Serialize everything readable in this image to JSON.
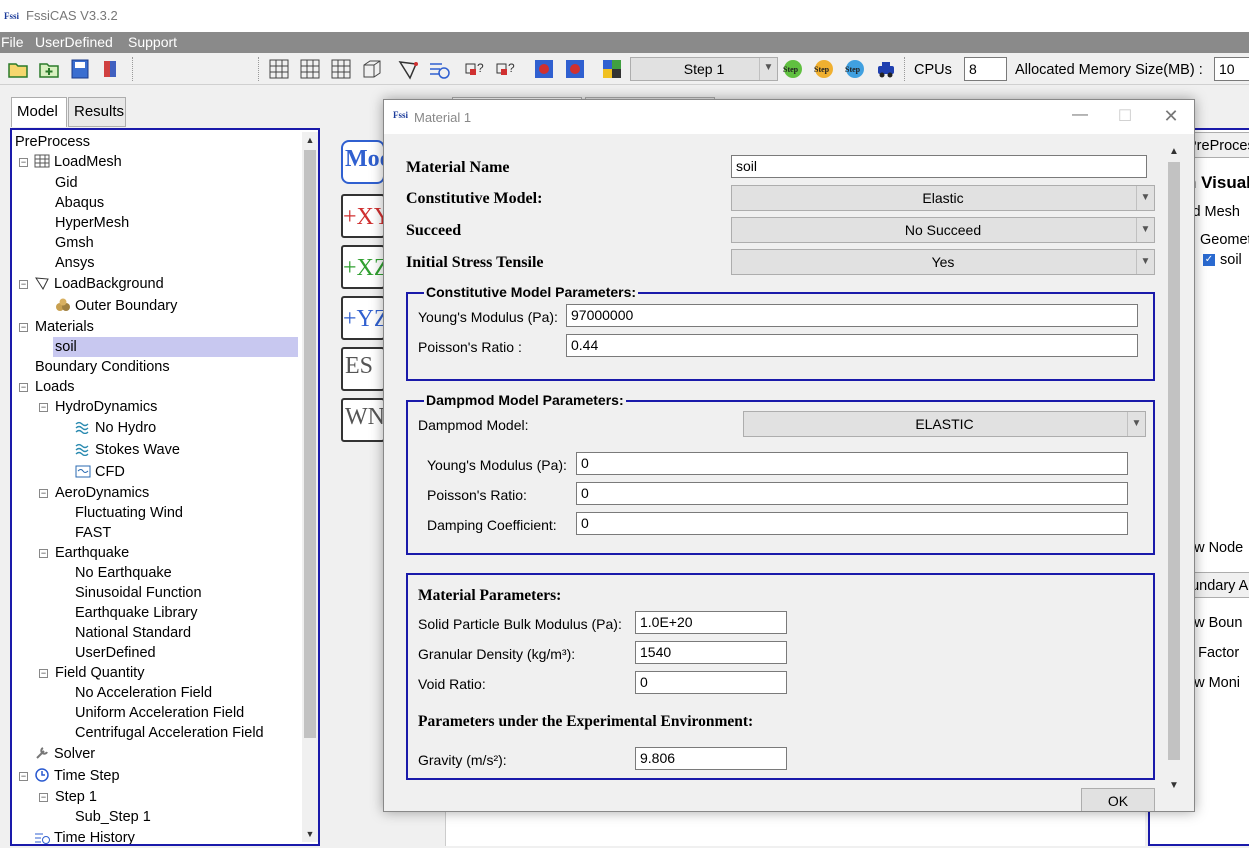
{
  "app": {
    "title": "FssiCAS V3.3.2",
    "logo_text": "FssiCAS"
  },
  "menu": [
    "File",
    "UserDefined",
    "Support"
  ],
  "toolbar": {
    "step_select": "Step 1",
    "step_buttons": [
      "Step",
      "Step",
      "Step"
    ],
    "cpus_label": "CPUs",
    "cpus_value": "8",
    "memory_label": "Allocated Memory Size(MB) :",
    "memory_value": "10"
  },
  "left_tabs": [
    "Model",
    "Results"
  ],
  "tree": {
    "root": "PreProcess",
    "load_mesh": "LoadMesh",
    "mesh_items": [
      "Gid",
      "Abaqus",
      "HyperMesh",
      "Gmsh",
      "Ansys"
    ],
    "load_background": "LoadBackground",
    "outer_boundary": "Outer Boundary",
    "materials": "Materials",
    "soil": "soil",
    "boundary_conditions": "Boundary Conditions",
    "loads": "Loads",
    "hydrodynamics": "HydroDynamics",
    "hydro_items": [
      "No Hydro",
      "Stokes Wave",
      "CFD"
    ],
    "aerodynamics": "AeroDynamics",
    "aero_items": [
      "Fluctuating Wind",
      "FAST"
    ],
    "earthquake": "Earthquake",
    "earthquake_items": [
      "No Earthquake",
      "Sinusoidal Function",
      "Earthquake Library",
      "National Standard",
      "UserDefined"
    ],
    "field_quantity": "Field Quantity",
    "field_items": [
      "No Acceleration Field",
      "Uniform Acceleration Field",
      "Centrifugal Acceleration Field"
    ],
    "solver": "Solver",
    "time_step": "Time Step",
    "step1": "Step 1",
    "sub_step": "Sub_Step 1",
    "time_history": "Time History"
  },
  "right_panel": {
    "tab": "PreProces",
    "heading": "n Visual",
    "items": [
      "lid Mesh",
      "Geomet",
      "soil",
      "ow Node",
      "oundary A",
      "ow Boun",
      "n Factor",
      "ow Moni"
    ]
  },
  "dialog": {
    "title": "Material 1",
    "material_name_label": "Material Name",
    "material_name_value": "soil",
    "constitutive_label": "Constitutive Model:",
    "constitutive_value": "Elastic",
    "succeed_label": "Succeed",
    "succeed_value": "No Succeed",
    "initial_stress_label": "Initial Stress Tensile",
    "initial_stress_value": "Yes",
    "cmp_title": "Constitutive Model Parameters:",
    "youngs_label": "Young's Modulus (Pa):",
    "youngs_value": "97000000",
    "poisson_label": "Poisson's Ratio :",
    "poisson_value": "0.44",
    "damp_title": "Dampmod Model Parameters:",
    "damp_model_label": "Dampmod Model:",
    "damp_model_value": "ELASTIC",
    "damp_youngs_label": "Young's Modulus (Pa):",
    "damp_youngs_value": "0",
    "damp_poisson_label": "Poisson's Ratio:",
    "damp_poisson_value": "0",
    "damping_coef_label": "Damping Coefficient:",
    "damping_coef_value": "0",
    "mat_params_title": "Material Parameters:",
    "bulk_label": "Solid Particle Bulk Modulus (Pa):",
    "bulk_value": "1.0E+20",
    "density_label": "Granular Density (kg/m³):",
    "density_value": "1540",
    "void_label": "Void Ratio:",
    "void_value": "0",
    "exp_env_title": "Parameters under the Experimental Environment:",
    "gravity_label": "Gravity (m/s²):",
    "gravity_value": "9.806",
    "ok_label": "OK"
  },
  "side_buttons": [
    "Mod",
    "+XY",
    "+XZ",
    "+YZ",
    "ES",
    "WN"
  ],
  "colors": {
    "panel_border": "#1a1aaa",
    "menubar": "#8a8a8a",
    "selection": "#c8c8f0"
  }
}
